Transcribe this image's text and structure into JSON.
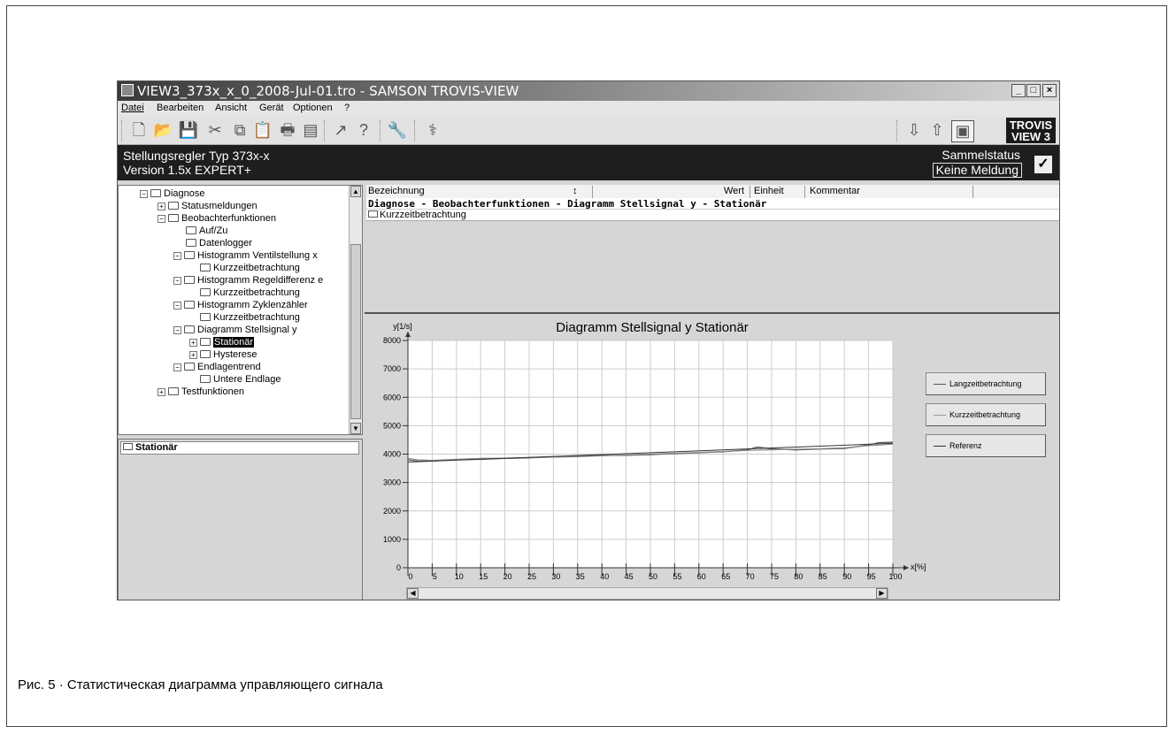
{
  "window": {
    "title": "VIEW3_373x_x_0_2008-Jul-01.tro - SAMSON TROVIS-VIEW",
    "controls": {
      "minimize": "_",
      "maximize": "□",
      "close": "×"
    }
  },
  "menu": {
    "items": [
      "Datei",
      "Bearbeiten",
      "Ansicht",
      "Gerät",
      "Optionen",
      "?"
    ]
  },
  "toolbar": {
    "icons": [
      "new-file-icon",
      "open-icon",
      "save-icon",
      "cut-icon",
      "copy-icon",
      "paste-icon",
      "print-icon",
      "print-preview-icon",
      "upload-icon",
      "help-icon",
      "wrench-icon",
      "stethoscope-icon",
      "download-icon",
      "upload-device-icon",
      "online-icon"
    ],
    "logo_line1": "TROVIS",
    "logo_line2": "VIEW 3"
  },
  "device": {
    "name": "Stellungsregler Typ 373x-x",
    "version": "Version 1.5x EXPERT+",
    "status_label": "Sammelstatus",
    "status_value": "Keine Meldung",
    "check": "✓"
  },
  "tree": {
    "items": [
      {
        "label": "Diagnose"
      },
      {
        "label": "Statusmeldungen"
      },
      {
        "label": "Beobachterfunktionen"
      },
      {
        "label": "Auf/Zu"
      },
      {
        "label": "Datenlogger"
      },
      {
        "label": "Histogramm Ventilstellung x"
      },
      {
        "label": "Kurzzeitbetrachtung"
      },
      {
        "label": "Histogramm Regeldifferenz e"
      },
      {
        "label": "Kurzzeitbetrachtung"
      },
      {
        "label": "Histogramm Zyklenzähler"
      },
      {
        "label": "Kurzzeitbetrachtung"
      },
      {
        "label": "Diagramm Stellsignal y"
      },
      {
        "label": "Stationär"
      },
      {
        "label": "Hysterese"
      },
      {
        "label": "Endlagentrend"
      },
      {
        "label": "Untere Endlage"
      },
      {
        "label": "Testfunktionen"
      }
    ]
  },
  "lower_panel": {
    "title": "Stationär"
  },
  "grid": {
    "columns": [
      "Bezeichnung",
      "Wert",
      "Einheit",
      "Kommentar"
    ],
    "sort_icon": "↕",
    "path_row": "Diagnose - Beobachterfunktionen - Diagramm Stellsignal y - Stationär",
    "folder_row": "Kurzzeitbetrachtung"
  },
  "chart_data": {
    "type": "line",
    "title": "Diagramm Stellsignal y Stationär",
    "ylabel": "y[1/s]",
    "xlabel": "x[%]",
    "xlim": [
      0,
      100
    ],
    "ylim": [
      0,
      8000
    ],
    "x_ticks": [
      0,
      5,
      10,
      15,
      20,
      25,
      30,
      35,
      40,
      45,
      50,
      55,
      60,
      65,
      70,
      75,
      80,
      85,
      90,
      95,
      100
    ],
    "y_ticks": [
      0,
      1000,
      2000,
      3000,
      4000,
      5000,
      6000,
      7000,
      8000
    ],
    "grid": true,
    "legend_placement": "right",
    "series": [
      {
        "name": "Langzeitbetrachtung",
        "color": "#555555",
        "x": [
          0,
          2,
          5,
          10,
          15,
          20,
          25,
          30,
          35,
          40,
          45,
          50,
          55,
          60,
          65,
          70,
          72,
          75,
          80,
          85,
          90,
          95,
          97,
          100
        ],
        "y": [
          3800,
          3750,
          3760,
          3800,
          3820,
          3850,
          3870,
          3900,
          3930,
          3950,
          3960,
          3980,
          4020,
          4050,
          4080,
          4150,
          4250,
          4180,
          4150,
          4180,
          4200,
          4320,
          4400,
          4420
        ]
      },
      {
        "name": "Kurzzeitbetrachtung",
        "color": "#888888",
        "x": [
          0,
          2,
          5,
          10,
          15,
          20,
          25,
          30,
          35,
          40,
          45,
          50,
          55,
          60,
          65,
          70,
          75,
          80,
          85,
          90,
          95,
          100
        ],
        "y": [
          3850,
          3800,
          3780,
          3820,
          3850,
          3860,
          3880,
          3890,
          3910,
          3940,
          3970,
          4000,
          4030,
          4060,
          4090,
          4130,
          4150,
          4170,
          4190,
          4220,
          4300,
          4350
        ]
      },
      {
        "name": "Referenz",
        "color": "#333333",
        "x": [
          0,
          100
        ],
        "y": [
          3720,
          4380
        ]
      }
    ]
  },
  "caption": "Рис. 5 · Статистическая диаграмма управляющего сигнала"
}
